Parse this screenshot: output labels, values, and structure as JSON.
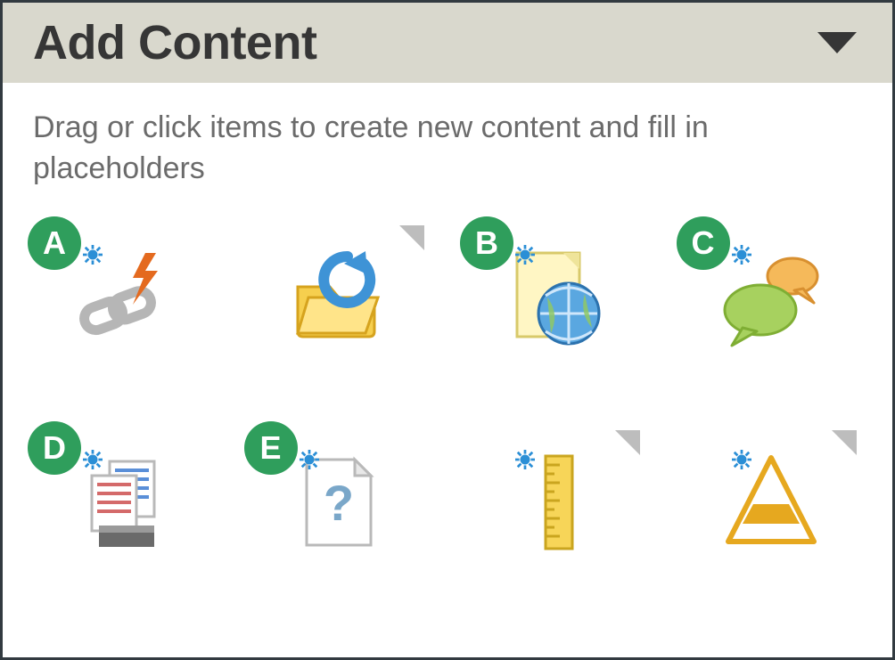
{
  "header": {
    "title": "Add Content"
  },
  "instructions": "Drag or click items to create new content and fill in placeholders",
  "badges": {
    "a": "A",
    "b": "B",
    "c": "C",
    "d": "D",
    "e": "E"
  },
  "tiles": [
    {
      "name": "link-tool",
      "badge": "a",
      "has_corner_flag": false
    },
    {
      "name": "open-folder",
      "badge": null,
      "has_corner_flag": true
    },
    {
      "name": "web-page",
      "badge": "b",
      "has_corner_flag": false
    },
    {
      "name": "discussion",
      "badge": "c",
      "has_corner_flag": false
    },
    {
      "name": "assessment-paper",
      "badge": "d",
      "has_corner_flag": false
    },
    {
      "name": "blank-question",
      "badge": "e",
      "has_corner_flag": false
    },
    {
      "name": "ruler-tool",
      "badge": null,
      "has_corner_flag": true
    },
    {
      "name": "pyramid-tool",
      "badge": null,
      "has_corner_flag": true
    }
  ]
}
